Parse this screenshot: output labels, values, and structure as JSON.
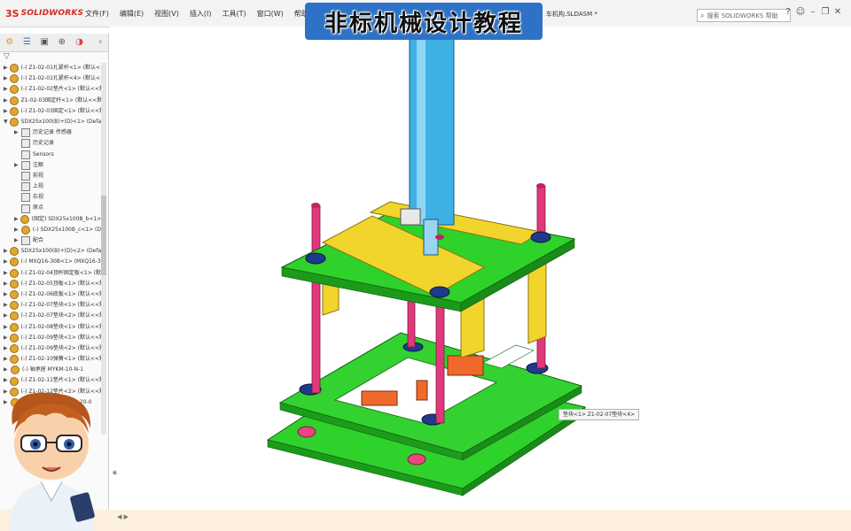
{
  "app": {
    "logo_ds": "3S",
    "logo_name": "SOLIDWORKS"
  },
  "menu": [
    "文件(F)",
    "编辑(E)",
    "视图(V)",
    "插入(I)",
    "工具(T)",
    "窗口(W)",
    "帮助(H)"
  ],
  "document": {
    "filename": "车机构.SLDASM *"
  },
  "search": {
    "placeholder": "搜索 SOLIDWORKS 帮助"
  },
  "banner": {
    "text": "非标机械设计教程"
  },
  "tree": {
    "items": [
      {
        "label": "(-) Z1-02-01扎紧杆<1> (默认<<默"
      },
      {
        "label": "(-) Z1-02-01扎紧杆<4> (默认<<默"
      },
      {
        "label": "(-) Z1-02-02垫片<1> (默认<<默认"
      },
      {
        "label": "Z1-02-03固定杆<1> (默认<<默认"
      },
      {
        "label": "(-) Z1-02-03固定<1> (默认<<默认"
      },
      {
        "label": "SDX25x100(B)+(D)<1> (Default<"
      },
      {
        "label": "历史记录  传感器"
      },
      {
        "label": "历史记录"
      },
      {
        "label": "Sensors"
      },
      {
        "label": "注解"
      },
      {
        "label": "前视"
      },
      {
        "label": "上视"
      },
      {
        "label": "右视"
      },
      {
        "label": "原点"
      },
      {
        "label": "(固定) SDX25x100B_b<1>"
      },
      {
        "label": "(-) SDX25x100B_c<1> (D"
      },
      {
        "label": "配合"
      },
      {
        "label": "SDX25x100(B)+(D)<2> (Default<"
      },
      {
        "label": "(-) MXQ16-30B<1> (MXQ16-30"
      },
      {
        "label": "(-) Z1-02-04顶杆固定板<1> (默认<<"
      },
      {
        "label": "(-) Z1-02-05顶板<1> (默认<<默认"
      },
      {
        "label": "(-) Z1-02-06底板<1> (默认<<默认"
      },
      {
        "label": "(-) Z1-02-07垫块<1> (默认<<默认"
      },
      {
        "label": "(-) Z1-02-07垫块<2> (默认<<默认"
      },
      {
        "label": "(-) Z1-02-08垫块<1> (默认<<默认"
      },
      {
        "label": "(-) Z1-02-09垫块<1> (默认<<默认"
      },
      {
        "label": "(-) Z1-02-09垫块<2> (默认<<默认"
      },
      {
        "label": "(-) Z1-02-10弹簧<1> (默认<<默认"
      },
      {
        "label": "(-) 轴承座 MYKM-10-N-1"
      },
      {
        "label": "(-) Z1-02-11垫片<1> (默认<<默认"
      },
      {
        "label": "(-) Z1-02-12垫片<2> (默认<<默认"
      },
      {
        "label": "SFJ1610-20 (SFJ1610-20-0"
      }
    ]
  },
  "tooltip": {
    "text": "垫块<1> Z1-02-07垫块<4>"
  },
  "colors": {
    "plate_green": "#2fd12b",
    "slider_yellow": "#f2d52c",
    "cylinder_blue": "#3fb0e4",
    "rod_pink": "#e0387a",
    "bushing_navy": "#1f3a8a",
    "banner_blue": "#2d72c7"
  }
}
